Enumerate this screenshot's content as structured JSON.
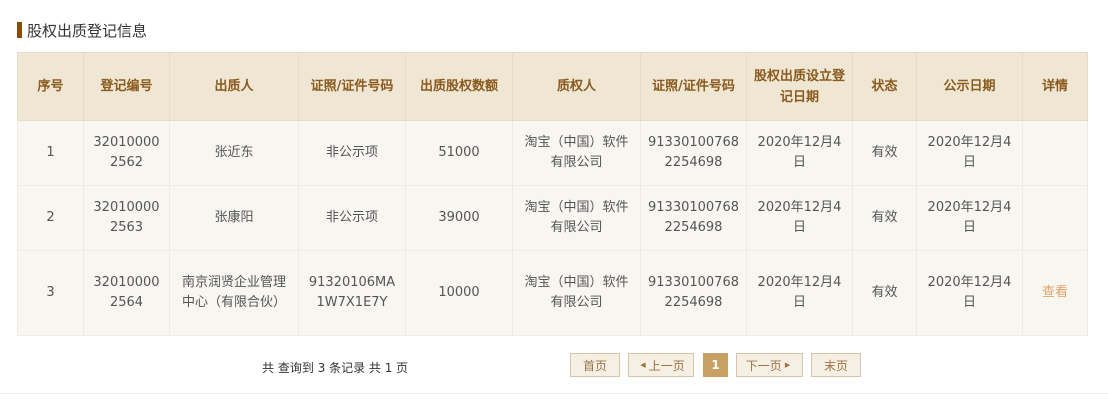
{
  "section": {
    "title": "股权出质登记信息"
  },
  "table": {
    "headers": {
      "seq": "序号",
      "reg_no": "登记编号",
      "pledgor": "出质人",
      "pledgor_id": "证照/证件号码",
      "amount": "出质股权数额",
      "pledgee": "质权人",
      "pledgee_id": "证照/证件号码",
      "reg_date": "股权出质设立登记日期",
      "status": "状态",
      "pub_date": "公示日期",
      "detail": "详情"
    },
    "rows": [
      {
        "seq": "1",
        "reg_no": "320100002562",
        "pledgor": "张近东",
        "pledgor_id": "非公示项",
        "amount": "51000",
        "pledgee": "淘宝（中国）软件有限公司",
        "pledgee_id": "913301007682254698",
        "reg_date": "2020年12月4日",
        "status": "有效",
        "pub_date": "2020年12月4日",
        "detail": ""
      },
      {
        "seq": "2",
        "reg_no": "320100002563",
        "pledgor": "张康阳",
        "pledgor_id": "非公示项",
        "amount": "39000",
        "pledgee": "淘宝（中国）软件有限公司",
        "pledgee_id": "913301007682254698",
        "reg_date": "2020年12月4日",
        "status": "有效",
        "pub_date": "2020年12月4日",
        "detail": ""
      },
      {
        "seq": "3",
        "reg_no": "320100002564",
        "pledgor": "南京润贤企业管理中心（有限合伙）",
        "pledgor_id": "91320106MA1W7X1E7Y",
        "amount": "10000",
        "pledgee": "淘宝（中国）软件有限公司",
        "pledgee_id": "913301007682254698",
        "reg_date": "2020年12月4日",
        "status": "有效",
        "pub_date": "2020年12月4日",
        "detail": "查看"
      }
    ]
  },
  "pagination": {
    "info": "共 查询到 3 条记录 共 1 页",
    "first": "首页",
    "prev": "上一页",
    "current": "1",
    "next": "下一页",
    "last": "末页",
    "prev_icon": "triangle-left-icon",
    "next_icon": "triangle-right-icon"
  },
  "colors": {
    "title_bar": "#8a4c08",
    "header_bg": "#efe6d4",
    "header_text": "#8a5a1e",
    "row_bg": "#f8f6f1",
    "link": "#e0a46a",
    "pager_active": "#c9a063"
  }
}
